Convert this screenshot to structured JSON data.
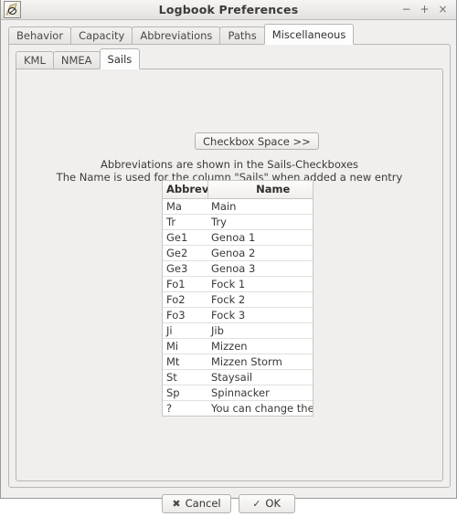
{
  "window": {
    "title": "Logbook Preferences",
    "icon": "quill-pen-icon",
    "controls": [
      {
        "name": "minimize",
        "glyph": "−"
      },
      {
        "name": "maximize",
        "glyph": "+"
      },
      {
        "name": "close",
        "glyph": "×"
      }
    ]
  },
  "outer_tabs": [
    {
      "label": "Behavior",
      "selected": false
    },
    {
      "label": "Capacity",
      "selected": false
    },
    {
      "label": "Abbreviations",
      "selected": false
    },
    {
      "label": "Paths",
      "selected": false
    },
    {
      "label": "Miscellaneous",
      "selected": true
    }
  ],
  "inner_tabs": [
    {
      "label": "KML",
      "selected": false
    },
    {
      "label": "NMEA",
      "selected": false
    },
    {
      "label": "Sails",
      "selected": true
    }
  ],
  "content": {
    "checkbox_space_button": "Checkbox Space  >>",
    "description_line1": "Abbreviations are shown in the Sails-Checkboxes",
    "description_line2": "The Name is used for the column \"Sails\" when added a new entry",
    "table": {
      "headers": [
        "Abbreviation",
        "Name"
      ],
      "rows": [
        [
          "Ma",
          "Main"
        ],
        [
          "Tr",
          "Try"
        ],
        [
          "Ge1",
          "Genoa 1"
        ],
        [
          "Ge2",
          "Genoa 2"
        ],
        [
          "Ge3",
          "Genoa 3"
        ],
        [
          "Fo1",
          "Fock 1"
        ],
        [
          "Fo2",
          "Fock 2"
        ],
        [
          "Fo3",
          "Fock 3"
        ],
        [
          "Ji",
          "Jib"
        ],
        [
          "Mi",
          "Mizzen"
        ],
        [
          "Mt",
          "Mizzen Storm"
        ],
        [
          "St",
          "Staysail"
        ],
        [
          "Sp",
          "Spinnacker"
        ],
        [
          "?",
          "You can change the abreviation and name"
        ]
      ]
    }
  },
  "buttons": {
    "cancel": {
      "label": "Cancel",
      "glyph": "✖"
    },
    "ok": {
      "label": "OK",
      "glyph": "✓"
    }
  },
  "colors": {
    "window_bg": "#f0efed",
    "panel_border": "#b8b6b3",
    "table_bg": "#ffffff",
    "text": "#3a3836"
  }
}
